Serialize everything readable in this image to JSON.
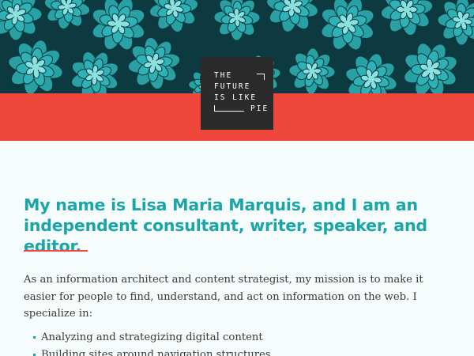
{
  "hero": {
    "image": "teal succulent rosettes photo",
    "colors": {
      "dark": "#0c3a40",
      "teal": "#2fb2b5",
      "light": "#8be0e0",
      "band": "#f0473c"
    }
  },
  "logo": {
    "lines": [
      "THE",
      "FUTURE",
      "IS LIKE",
      "PIE"
    ],
    "background": "#2b2b2b"
  },
  "intro_heading": {
    "before": "My name is ",
    "name": "Lisa Maria Marquis",
    "after": ", and I am an independent consultant, writer, speaker, and editor.",
    "color": "#1aa5a6"
  },
  "intro_paragraph": "As an information architect and content strategist, my mission is to make it easier for people to find, understand, and act on information on the web. I specialize in:",
  "skills": [
    "Analyzing and strategizing digital content",
    "Building sites around navigation structures"
  ],
  "accent_color": "#f0473c"
}
